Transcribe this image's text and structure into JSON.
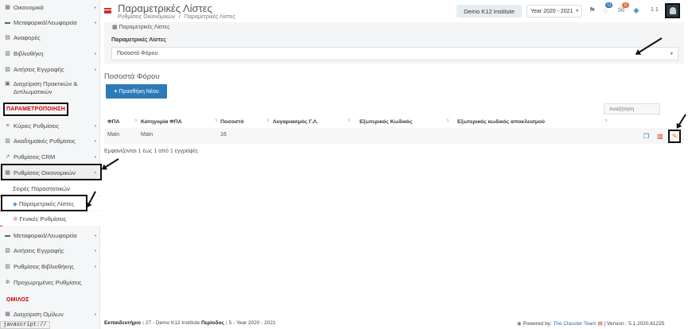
{
  "sidebar": {
    "items_top": [
      {
        "label": "Οικονομικά",
        "icon": "money-icon"
      },
      {
        "label": "Μεταφορικά/Λεωφορεία",
        "icon": "bus-icon"
      },
      {
        "label": "Αναφορές",
        "icon": "printer-icon"
      },
      {
        "label": "Βιβλιοθήκη",
        "icon": "library-icon"
      },
      {
        "label": "Αιτήσεις Εγγραφής",
        "icon": "form-icon"
      },
      {
        "label": "Διαχείριση Πρακτικών & Διπλωματικών",
        "icon": "document-icon"
      }
    ],
    "section_param": "ΠΑΡΑΜΕΤΡΟΠΟΙΗΣΗ",
    "items_param": [
      {
        "label": "Κύριες Ρυθμίσεις",
        "icon": "sliders-icon"
      },
      {
        "label": "Ακαδημαϊκές Ρυθμίσεις",
        "icon": "academic-icon"
      },
      {
        "label": "Ρυθμίσεις CRM",
        "icon": "chart-icon"
      },
      {
        "label": "Ρυθμίσεις Οικονομικών",
        "icon": "money-icon"
      }
    ],
    "sub_items": [
      {
        "label": "Σειρές Παραστατικών"
      },
      {
        "label": "Παραμετρικές Λίστες"
      },
      {
        "label": "Γενικές Ρυθμίσεις"
      }
    ],
    "items_after": [
      {
        "label": "Μεταφορικά/Λεωφορεία",
        "icon": "bus-icon"
      },
      {
        "label": "Αιτήσεις Εγγραφής",
        "icon": "form-icon"
      },
      {
        "label": "Ρυθμίσεις Βιβλιοθήκης",
        "icon": "library-icon"
      },
      {
        "label": "Προχωρημένες Ρυθμίσεις",
        "icon": "gears-icon"
      }
    ],
    "section_group": "ΟΜΙΛΟΣ",
    "items_group": [
      {
        "label": "Διαχείριση Ομίλων",
        "icon": "group-icon"
      }
    ]
  },
  "header": {
    "title": "Παραμετρικές Λίστες",
    "breadcrumb": [
      "Ρυθμίσεις Οικονομικών",
      "Παραμετρικές Λίστες"
    ],
    "breadcrumb_sep": "/",
    "institute": "Demo K12 Institute",
    "year": "Year 2020 - 2021",
    "notif_count": "13",
    "mail_count": "0",
    "user_label": "1 1"
  },
  "filter": {
    "panel_title": "Παραμετρικές Λίστες",
    "label": "Παραμετρικές Λίστες",
    "selected": "Ποσοστά Φόρου"
  },
  "content": {
    "section_title": "Ποσοστά Φόρου",
    "add_button": "Προσθήκη Νέου",
    "search_placeholder": "Αναζήτηση",
    "columns": [
      "ΦΠΑ",
      "Κατηγορία ΦΠΑ",
      "Ποσοστό",
      "Λογαριασμός Γ.Λ.",
      "Εξωτερικός Κωδικός",
      "Εξωτερικός κωδικός αποκλεισμού"
    ],
    "rows": [
      {
        "vat": "Main",
        "category": "Main",
        "percent": "16",
        "account": "",
        "ext_code": "",
        "ext_exclusion": ""
      }
    ],
    "info": "Εμφανίζονται 1 έως 1 από 1 εγγραφές"
  },
  "footer": {
    "institute_label": "Εκπαιδευτήριο :",
    "institute_value": "27 - Demo K12 Institute",
    "period_label": "Περίοδος :",
    "period_value": "5 - Year 2020 - 2021",
    "powered_by": "Powered by:",
    "team": "The Classter Team",
    "version": "| Version : 5.1.2020.61225"
  },
  "status_bar": "javascript://",
  "colors": {
    "accent": "#d32f2f",
    "primary_button": "#2d7ab8",
    "sidebar_bg": "#f5f6f7"
  }
}
